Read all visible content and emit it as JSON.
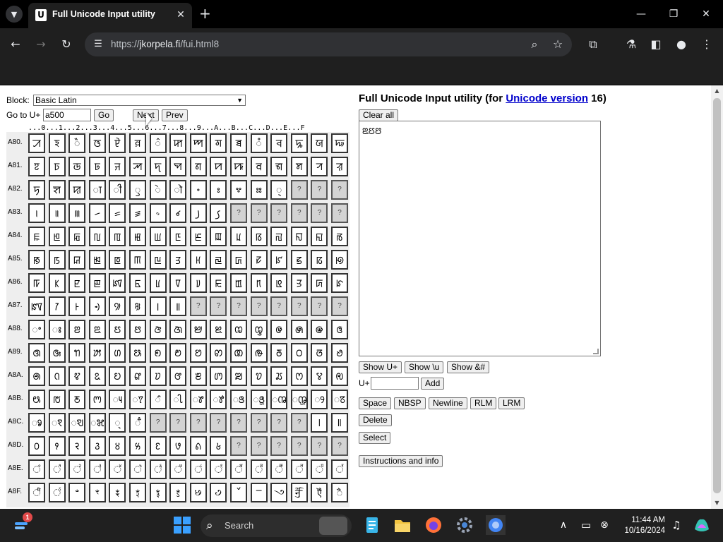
{
  "browser": {
    "tab_title": "Full Unicode Input utility",
    "url_scheme": "https://",
    "url_host": "jkorpela.fi",
    "url_path": "/fui.html8",
    "icons": {
      "tab_menu": "chevron-down-icon",
      "favicon": "u-logo-icon",
      "close": "close-icon",
      "new_tab": "plus-icon",
      "back": "back-arrow-icon",
      "forward": "forward-arrow-icon",
      "reload": "reload-icon",
      "site_info": "tune-icon",
      "zoom": "zoom-icon",
      "bookmark": "star-icon",
      "extensions": "puzzle-icon",
      "labs": "flask-icon",
      "side_panel": "side-panel-icon",
      "profile": "person-icon",
      "menu": "kebab-icon"
    }
  },
  "left_panel": {
    "block_label": "Block:",
    "block_value": "Basic Latin",
    "goto_label": "Go to U+",
    "goto_value": "a500",
    "go_button": "Go",
    "next_button": "Next",
    "prev_button": "Prev",
    "ruler": "...0...1...2...3...4...5...6...7...8...9...A...B...C...D...E...F",
    "rows": [
      {
        "label": "A80.",
        "cells": [
          "ꠀ",
          "ꠁ",
          "ꠂ",
          "ꠃ",
          "ꠄ",
          "ꠅ",
          "꠆",
          "ꠇ",
          "ꠈ",
          "ꠉ",
          "ꠊ",
          "ꠋ",
          "ꠌ",
          "ꠍ",
          "ꠎ",
          "ꠏ"
        ]
      },
      {
        "label": "A81.",
        "cells": [
          "ꠐ",
          "ꠑ",
          "ꠒ",
          "ꠓ",
          "ꠔ",
          "ꠕ",
          "ꠖ",
          "ꠗ",
          "ꠘ",
          "ꠙ",
          "ꠚ",
          "ꠛ",
          "ꠜ",
          "ꠝ",
          "ꠞ",
          "ꠟ"
        ]
      },
      {
        "label": "A82.",
        "cells": [
          "ꠠ",
          "ꠡ",
          "ꠢ",
          "ꠣ",
          "ꠤ",
          "ꠥ",
          "ꠦ",
          "ꠧ",
          "꠨",
          "꠩",
          "꠪",
          "꠫",
          "꠬",
          "?",
          "?",
          "?"
        ]
      },
      {
        "label": "A83.",
        "cells": [
          "꠰",
          "꠱",
          "꠲",
          "꠳",
          "꠴",
          "꠵",
          "꠶",
          "꠷",
          "꠸",
          "꠹",
          "?",
          "?",
          "?",
          "?",
          "?",
          "?"
        ]
      },
      {
        "label": "A84.",
        "cells": [
          "ꡀ",
          "ꡁ",
          "ꡂ",
          "ꡃ",
          "ꡄ",
          "ꡅ",
          "ꡆ",
          "ꡇ",
          "ꡈ",
          "ꡉ",
          "ꡊ",
          "ꡋ",
          "ꡌ",
          "ꡍ",
          "ꡎ",
          "ꡏ"
        ]
      },
      {
        "label": "A85.",
        "cells": [
          "ꡐ",
          "ꡑ",
          "ꡒ",
          "ꡓ",
          "ꡔ",
          "ꡕ",
          "ꡖ",
          "ꡗ",
          "ꡘ",
          "ꡙ",
          "ꡚ",
          "ꡛ",
          "ꡜ",
          "ꡝ",
          "ꡞ",
          "ꡟ"
        ]
      },
      {
        "label": "A86.",
        "cells": [
          "ꡠ",
          "ꡡ",
          "ꡢ",
          "ꡣ",
          "ꡤ",
          "ꡥ",
          "ꡦ",
          "ꡧ",
          "ꡨ",
          "ꡩ",
          "ꡪ",
          "ꡫ",
          "ꡬ",
          "ꡭ",
          "ꡮ",
          "ꡯ"
        ]
      },
      {
        "label": "A87.",
        "cells": [
          "ꡰ",
          "ꡱ",
          "ꡲ",
          "ꡳ",
          "꡴",
          "꡵",
          "꡶",
          "꡷",
          "?",
          "?",
          "?",
          "?",
          "?",
          "?",
          "?",
          "?"
        ]
      },
      {
        "label": "A88.",
        "cells": [
          "ꢀ",
          "ꢁ",
          "ꢂ",
          "ꢃ",
          "ꢄ",
          "ꢅ",
          "ꢆ",
          "ꢇ",
          "ꢈ",
          "ꢉ",
          "ꢊ",
          "ꢋ",
          "ꢌ",
          "ꢍ",
          "ꢎ",
          "ꢏ"
        ]
      },
      {
        "label": "A89.",
        "cells": [
          "ꢐ",
          "ꢑ",
          "ꢒ",
          "ꢓ",
          "ꢔ",
          "ꢕ",
          "ꢖ",
          "ꢗ",
          "ꢘ",
          "ꢙ",
          "ꢚ",
          "ꢛ",
          "ꢜ",
          "ꢝ",
          "ꢞ",
          "ꢟ"
        ]
      },
      {
        "label": "A8A.",
        "cells": [
          "ꢠ",
          "ꢡ",
          "ꢢ",
          "ꢣ",
          "ꢤ",
          "ꢥ",
          "ꢦ",
          "ꢧ",
          "ꢨ",
          "ꢩ",
          "ꢪ",
          "ꢫ",
          "ꢬ",
          "ꢭ",
          "ꢮ",
          "ꢯ"
        ]
      },
      {
        "label": "A8B.",
        "cells": [
          "ꢰ",
          "ꢱ",
          "ꢲ",
          "ꢳ",
          "ꢴ",
          "ꢵ",
          "ꢶ",
          "ꢷ",
          "ꢸ",
          "ꢹ",
          "ꢺ",
          "ꢻ",
          "ꢼ",
          "ꢽ",
          "ꢾ",
          "ꢿ"
        ]
      },
      {
        "label": "A8C.",
        "cells": [
          "ꣀ",
          "ꣁ",
          "ꣂ",
          "ꣃ",
          "꣄",
          "ꣅ",
          "?",
          "?",
          "?",
          "?",
          "?",
          "?",
          "?",
          "?",
          "꣎",
          "꣏"
        ]
      },
      {
        "label": "A8D.",
        "cells": [
          "꣐",
          "꣑",
          "꣒",
          "꣓",
          "꣔",
          "꣕",
          "꣖",
          "꣗",
          "꣘",
          "꣙",
          "?",
          "?",
          "?",
          "?",
          "?",
          "?"
        ]
      },
      {
        "label": "A8E.",
        "cells": [
          "꣠",
          "꣡",
          "꣢",
          "꣣",
          "꣤",
          "꣥",
          "꣦",
          "꣧",
          "꣨",
          "꣩",
          "꣪",
          "꣫",
          "꣬",
          "꣭",
          "꣮",
          "꣯"
        ]
      },
      {
        "label": "A8F.",
        "cells": [
          "꣰",
          "꣱",
          "ꣲ",
          "ꣳ",
          "ꣴ",
          "ꣵ",
          "ꣶ",
          "ꣷ",
          "꣸",
          "꣹",
          "꣺",
          "ꣻ",
          "꣼",
          "ꣽ",
          "ꣾ",
          "ꣿ"
        ]
      }
    ]
  },
  "right_panel": {
    "title_prefix": "Full Unicode Input utility (for ",
    "title_link": "Unicode version",
    "title_suffix": " 16)",
    "clear_all": "Clear all",
    "textarea_value": "ꢃꢄꢅ",
    "show_uplus": "Show U+",
    "show_backslash_u": "Show \\u",
    "show_amp_hash": "Show &#",
    "uplus_label": "U+",
    "add_button": "Add",
    "space_button": "Space",
    "nbsp_button": "NBSP",
    "newline_button": "Newline",
    "rlm_button": "RLM",
    "lrm_button": "LRM",
    "delete_button": "Delete",
    "select_button": "Select",
    "instructions_button": "Instructions and info"
  },
  "taskbar": {
    "search_text": "Search",
    "notification_count": "1",
    "time": "11:44 AM",
    "date": "10/16/2024"
  }
}
